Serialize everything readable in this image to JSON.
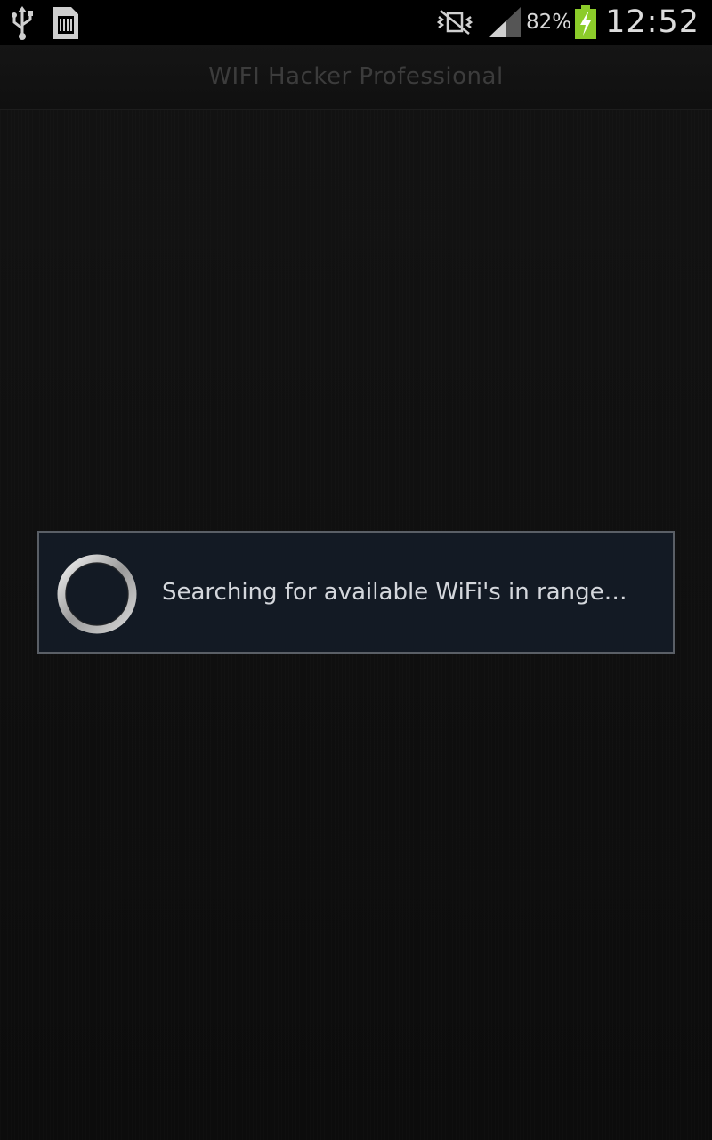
{
  "status_bar": {
    "icons_left": [
      "usb-icon",
      "sd-card-icon"
    ],
    "icons_right": [
      "vibrate-mute-icon",
      "signal-icon"
    ],
    "battery_percent": "82%",
    "battery_icon": "battery-charging-icon",
    "time": "12:52"
  },
  "title_bar": {
    "title": "WIFI Hacker Professional"
  },
  "dialog": {
    "spinner_icon": "spinner-icon",
    "message": "Searching for available WiFi's in range…"
  },
  "colors": {
    "status_bar_bg": "#000000",
    "background": "#0e0e0e",
    "dialog_bg": "#131a24",
    "dialog_border": "#5a5f66",
    "battery_green": "#8ccc2a"
  }
}
